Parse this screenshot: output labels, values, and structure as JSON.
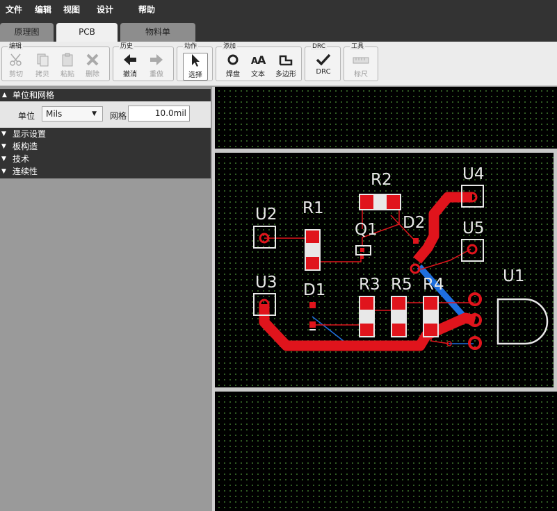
{
  "menu": {
    "file": "文件",
    "edit": "编辑",
    "view": "视图",
    "design": "设计",
    "help": "帮助"
  },
  "tabs": [
    {
      "label": "原理图",
      "active": false
    },
    {
      "label": "PCB",
      "active": true
    },
    {
      "label": "物料单",
      "active": false
    }
  ],
  "toolbar": {
    "edit_group": "编辑",
    "cut": "剪切",
    "copy": "拷贝",
    "paste": "粘贴",
    "delete": "删除",
    "history_group": "历史",
    "undo": "撤消",
    "redo": "重做",
    "action_group": "动作",
    "select": "选择",
    "add_group": "添加",
    "pad": "焊盘",
    "text": "文本",
    "polygon": "多边形",
    "drc_group": "DRC",
    "drc": "DRC",
    "tools_group": "工具",
    "ruler": "标尺"
  },
  "panel": {
    "units_grid_title": "单位和网格",
    "units_label": "单位",
    "units_value": "Mils",
    "grid_label": "网格",
    "grid_value": "10.0mil",
    "sections": [
      "显示设置",
      "板构造",
      "技术",
      "连续性"
    ]
  },
  "pcb": {
    "components": [
      "U1",
      "U2",
      "U3",
      "U4",
      "U5",
      "R1",
      "R2",
      "R3",
      "R4",
      "R5",
      "Q1",
      "D1",
      "D2"
    ],
    "colors": {
      "top_copper": "#e0141c",
      "bottom_copper": "#1e6fe0",
      "silkscreen": "#e8e8e8",
      "board_edge": "#c8c8c8"
    }
  }
}
